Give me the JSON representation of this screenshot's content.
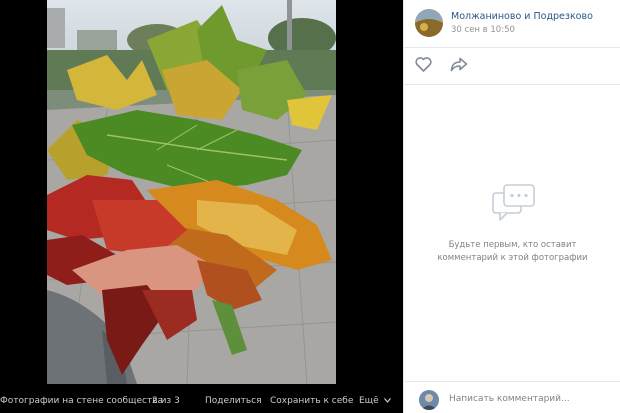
{
  "post": {
    "group_name": "Молжаниново и Подрезково",
    "date": "30 сен в 10:50"
  },
  "actions": {
    "like_icon": "heart-icon",
    "share_icon": "share-arrow-icon"
  },
  "comments": {
    "empty_line1": "Будьте первым, кто оставит",
    "empty_line2": "комментарий к этой фотографии",
    "empty_icon": "chat-bubble-icon",
    "input_placeholder": "Написать комментарий..."
  },
  "viewer": {
    "album_label": "Фотографии на стене сообщества",
    "counter": "2 из 3",
    "share_label": "Поделиться",
    "save_label": "Сохранить к себе",
    "more_label": "Ещё"
  },
  "colors": {
    "link": "#2a5885",
    "muted": "#828282",
    "viewer_bg": "#000000",
    "icon_gray": "#828a99"
  }
}
